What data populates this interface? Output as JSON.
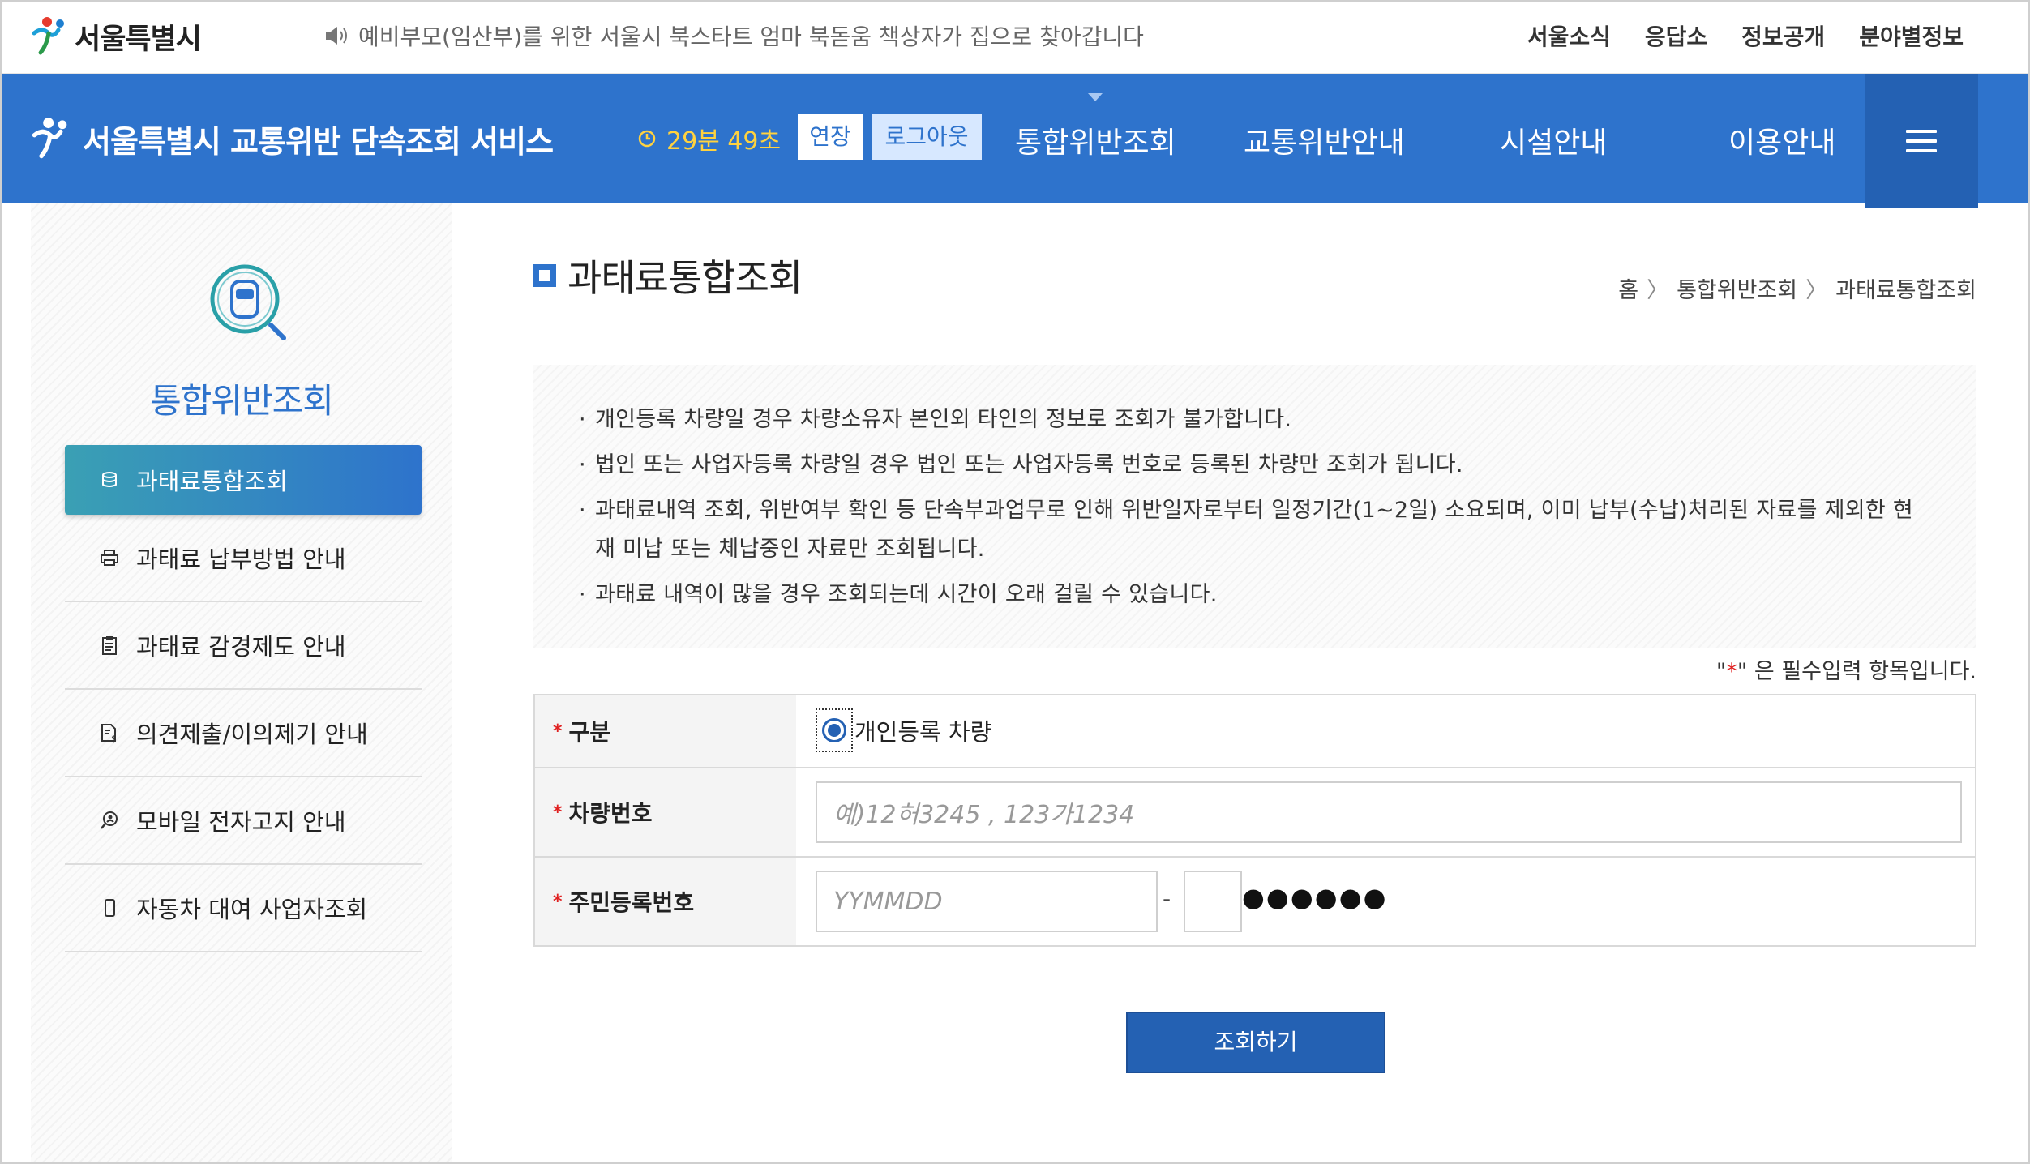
{
  "top": {
    "logo_text": "서울특별시",
    "notice": "예비부모(임산부)를 위한 서울시 북스타트 엄마 북돋움 책상자가 집으로 찾아갑니다",
    "util_nav": [
      "서울소식",
      "응답소",
      "정보공개",
      "분야별정보"
    ]
  },
  "header": {
    "service_title": "서울특별시 교통위반 단속조회 서비스",
    "timer": "29분 49초",
    "extend_label": "연장",
    "logout_label": "로그아웃",
    "nav": [
      "통합위반조회",
      "교통위반안내",
      "시설안내",
      "이용안내"
    ],
    "colors": {
      "primary": "#2e73cc",
      "timer": "#ffd23f"
    }
  },
  "sidebar": {
    "title": "통합위반조회",
    "active_item": "과태료통합조회",
    "items": [
      {
        "label": "과태료 납부방법 안내",
        "icon": "printer-icon"
      },
      {
        "label": "과태료 감경제도 안내",
        "icon": "clipboard-icon"
      },
      {
        "label": "의견제출/이의제기 안내",
        "icon": "document-money-icon"
      },
      {
        "label": "모바일 전자고지 안내",
        "icon": "search-person-icon"
      },
      {
        "label": "자동차 대여 사업자조회",
        "icon": "phone-icon"
      }
    ]
  },
  "content": {
    "page_title": "과태료통합조회",
    "breadcrumb": [
      "홈",
      "통합위반조회",
      "과태료통합조회"
    ],
    "notices": [
      "개인등록 차량일 경우 차량소유자 본인외 타인의 정보로 조회가 불가합니다.",
      "법인 또는 사업자등록 차량일 경우 법인 또는 사업자등록 번호로 등록된 차량만 조회가 됩니다.",
      "과태료내역 조회, 위반여부 확인 등 단속부과업무로 인해 위반일자로부터 일정기간(1~2일) 소요되며, 이미 납부(수납)처리된 자료를 제외한 현재 미납 또는 체납중인 자료만 조회됩니다.",
      "과태료 내역이 많을 경우 조회되는데 시간이 오래 걸릴 수 있습니다."
    ],
    "required_note_prefix": "\"",
    "required_star": "*",
    "required_note_suffix": "\" 은 필수입력 항목입니다.",
    "form": {
      "type_label": "구분",
      "type_value": "개인등록 차량",
      "car_label": "차량번호",
      "car_placeholder": "예)12허3245 , 123가1234",
      "id_label": "주민등록번호",
      "id_placeholder": "YYMMDD",
      "id_dash": "-",
      "id_mask": "●●●●●●"
    },
    "submit_label": "조회하기"
  }
}
